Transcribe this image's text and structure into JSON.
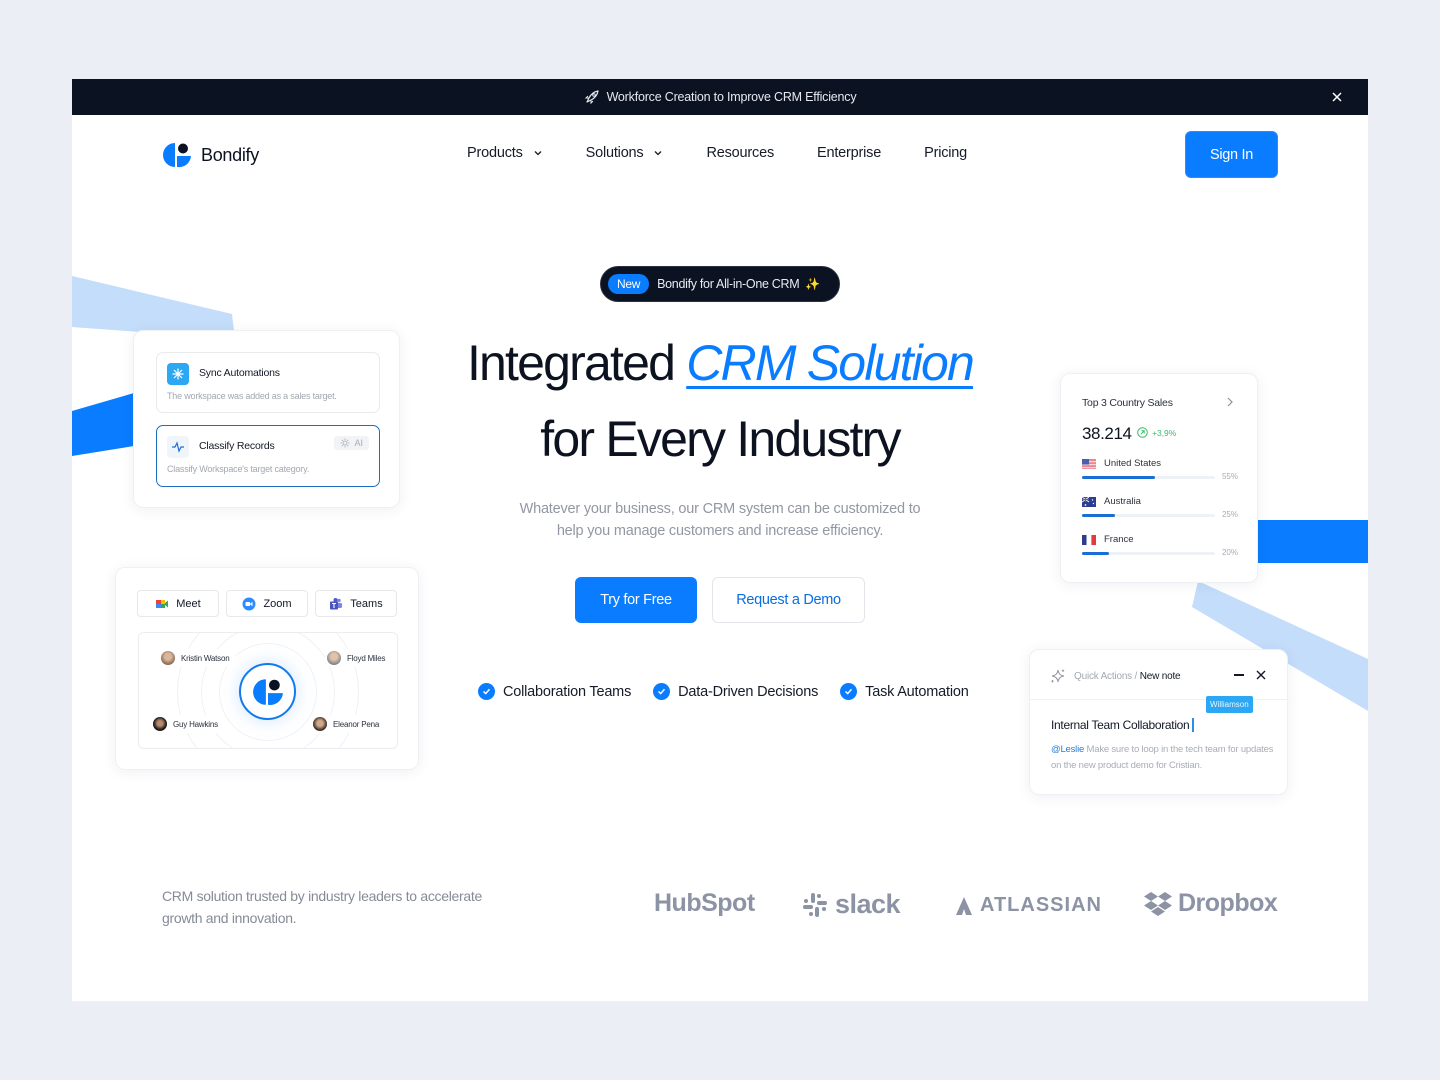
{
  "announcement": {
    "icon": "rocket-icon",
    "text": "Workforce Creation to Improve CRM Efficiency",
    "close_icon": "close-icon"
  },
  "header": {
    "brand": "Bondify",
    "nav": [
      {
        "label": "Products",
        "has_dropdown": true
      },
      {
        "label": "Solutions",
        "has_dropdown": true
      },
      {
        "label": "Resources",
        "has_dropdown": false
      },
      {
        "label": "Enterprise",
        "has_dropdown": false
      },
      {
        "label": "Pricing",
        "has_dropdown": false
      }
    ],
    "sign_in": "Sign In"
  },
  "hero": {
    "badge_tag": "New",
    "badge_text": "Bondify for All-in-One CRM",
    "badge_icon": "sparkles-icon",
    "title_line1_plain": "Integrated ",
    "title_line1_accent": "CRM Solution",
    "title_line2": "for Every Industry",
    "subtitle_line1": "Whatever your business, our CRM system can be customized to",
    "subtitle_line2": "help you manage customers and increase efficiency.",
    "cta_primary": "Try for Free",
    "cta_secondary": "Request a Demo",
    "features": [
      "Collaboration Teams",
      "Data-Driven Decisions",
      "Task Automation"
    ]
  },
  "automations_card": {
    "items": [
      {
        "title": "Sync Automations",
        "description": "The workspace was added as a sales target.",
        "icon": "snowflake-icon",
        "selected": false
      },
      {
        "title": "Classify Records",
        "description": "Classify Workspace's target category.",
        "icon": "activity-icon",
        "selected": true,
        "chip": "AI"
      }
    ]
  },
  "meetings_card": {
    "apps": [
      {
        "label": "Meet",
        "icon": "google-meet-icon"
      },
      {
        "label": "Zoom",
        "icon": "zoom-icon"
      },
      {
        "label": "Teams",
        "icon": "teams-icon"
      }
    ],
    "people": [
      "Kristin Watson",
      "Floyd Miles",
      "Guy Hawkins",
      "Eleanor Pena"
    ]
  },
  "sales_card": {
    "title": "Top 3 Country Sales",
    "total": "38.214",
    "change": "+3,9%",
    "countries": [
      {
        "name": "United States",
        "percent": 55,
        "percent_label": "55%"
      },
      {
        "name": "Australia",
        "percent": 25,
        "percent_label": "25%"
      },
      {
        "name": "France",
        "percent": 20,
        "percent_label": "20%"
      }
    ],
    "colors": {
      "bar": "#1a6fd6",
      "trend": "#3ebc6b"
    }
  },
  "note_card": {
    "breadcrumb_parent": "Quick Actions /",
    "breadcrumb_current": "New note",
    "collaborator_tag": "Williamson",
    "title": "Internal Team Collaboration",
    "mention": "@Leslie",
    "body": " Make sure to loop in the tech team for updates on the new product demo for Cristian."
  },
  "trusted": {
    "text": "CRM solution trusted by industry leaders to accelerate growth and innovation.",
    "logos": [
      "HubSpot",
      "slack",
      "ATLASSIAN",
      "Dropbox"
    ]
  },
  "colors": {
    "primary": "#0a7cff",
    "dark": "#0b1322",
    "light_blue": "#c4ddfb"
  }
}
